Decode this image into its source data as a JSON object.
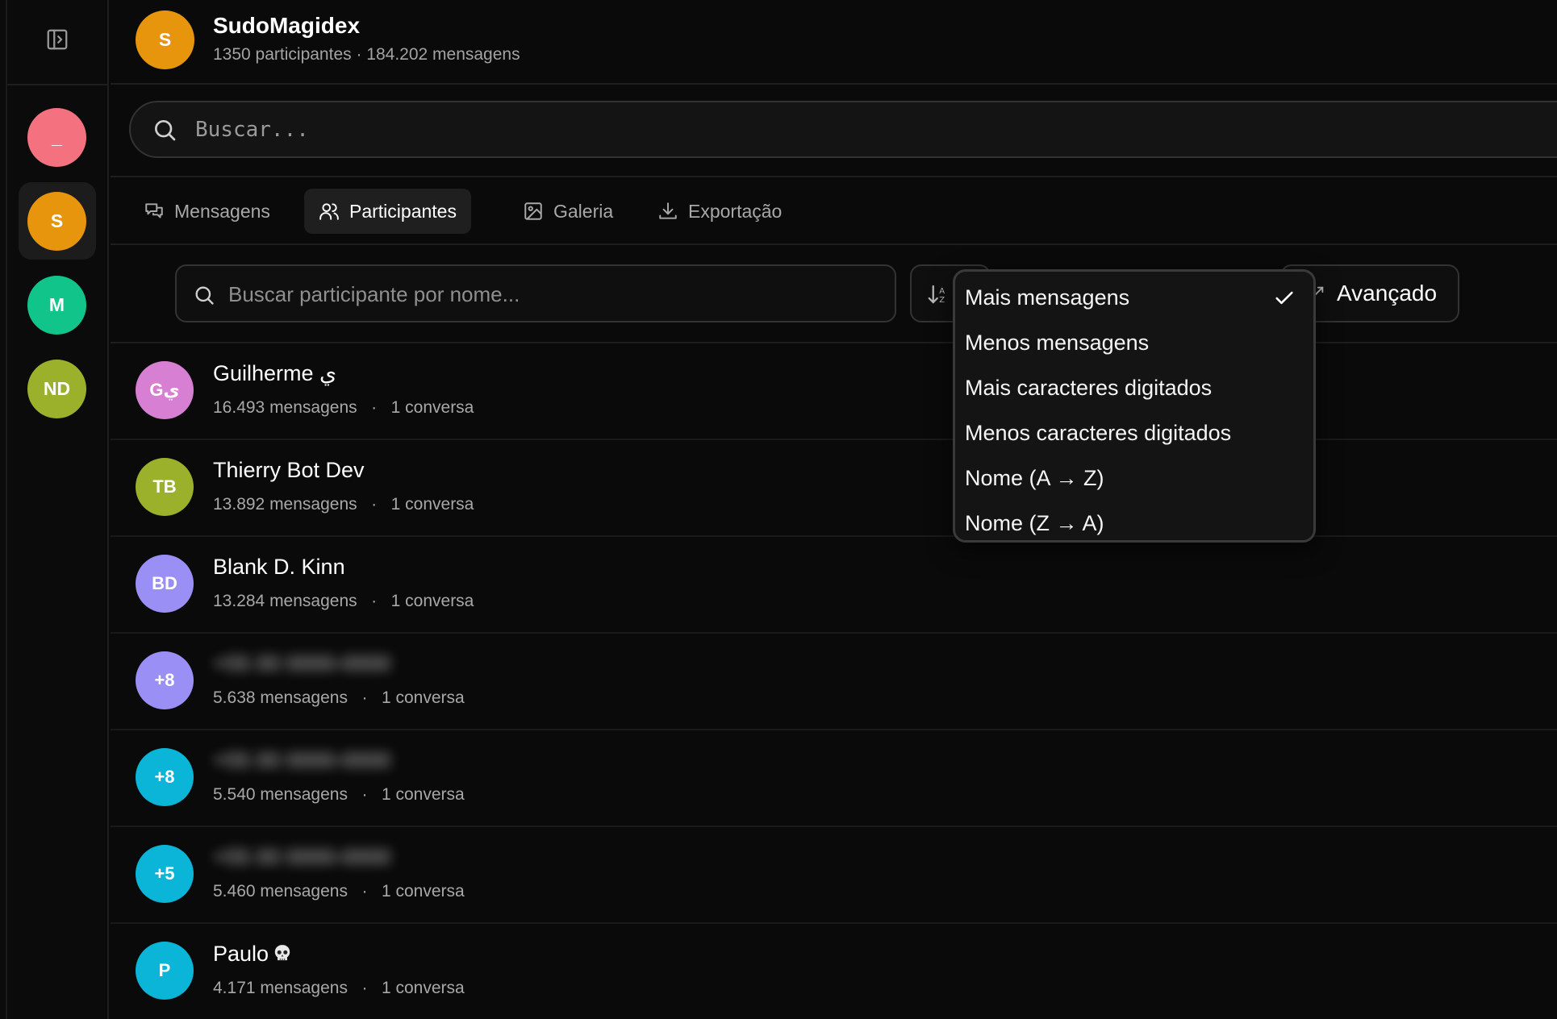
{
  "rail": {
    "chats": [
      {
        "initials": "_",
        "color": "#f4727f"
      },
      {
        "initials": "S",
        "color": "#e8950e"
      },
      {
        "initials": "M",
        "color": "#10c48a"
      },
      {
        "initials": "ND",
        "color": "#9bb02b"
      }
    ]
  },
  "header": {
    "initials": "S",
    "title": "SudoMagidex",
    "subtitle": "1350 participantes · 184.202 mensagens"
  },
  "search": {
    "placeholder": "Buscar..."
  },
  "tabs": [
    {
      "label": "Mensagens"
    },
    {
      "label": "Participantes"
    },
    {
      "label": "Galeria"
    },
    {
      "label": "Exportação"
    }
  ],
  "filter": {
    "placeholder": "Buscar participante por nome...",
    "advanced_label": "Avançado"
  },
  "sort_menu": {
    "options": [
      "Mais mensagens",
      "Menos mensagens",
      "Mais caracteres digitados",
      "Menos caracteres digitados",
      "Nome (A → Z)",
      "Nome (Z → A)"
    ],
    "selected": "Mais mensagens"
  },
  "participants": [
    {
      "initials": "Gي",
      "name": "Guilherme ي",
      "messages": "16.493 mensagens",
      "conversations": "1 conversa",
      "color": "#d77fd2"
    },
    {
      "initials": "TB",
      "name": "Thierry Bot Dev",
      "messages": "13.892 mensagens",
      "conversations": "1 conversa",
      "color": "#9bb02b"
    },
    {
      "initials": "BD",
      "name": "Blank D. Kinn",
      "messages": "13.284 mensagens",
      "conversations": "1 conversa",
      "color": "#9a8ff5"
    },
    {
      "initials": "+8",
      "name": "+55 00 0000-0000",
      "messages": "5.638 mensagens",
      "conversations": "1 conversa",
      "color": "#9a8ff5"
    },
    {
      "initials": "+8",
      "name": "+55 00 0000-0000",
      "messages": "5.540 mensagens",
      "conversations": "1 conversa",
      "color": "#0ab5d8"
    },
    {
      "initials": "+5",
      "name": "+55 00 0000-0000",
      "messages": "5.460 mensagens",
      "conversations": "1 conversa",
      "color": "#0ab5d8"
    },
    {
      "initials": "P",
      "name": "Paulo",
      "messages": "4.171 mensagens",
      "conversations": "1 conversa",
      "color": "#0ab5d8"
    }
  ]
}
